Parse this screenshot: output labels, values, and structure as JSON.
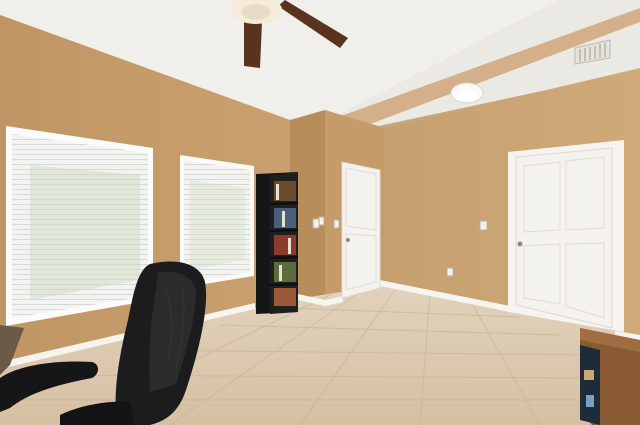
{
  "scene": {
    "kind": "interior-room-photo",
    "palette": {
      "wall": "#c49a68",
      "wall_shadow": "#b48a5a",
      "ceiling": "#f1f0ec",
      "floor": "#ddc9ae",
      "trim": "#f6f4ef",
      "door": "#f4f2ee",
      "shelf": "#1a1a1a",
      "chair": "#1c1c1e",
      "desk": "#8a5a33",
      "fan_blade": "#5a3220"
    },
    "objects": [
      "ceiling-fan",
      "ceiling-light",
      "window-left",
      "window-center",
      "bookshelf",
      "door-middle",
      "door-right",
      "office-chair",
      "wooden-desk",
      "air-vent",
      "light-switches"
    ]
  }
}
